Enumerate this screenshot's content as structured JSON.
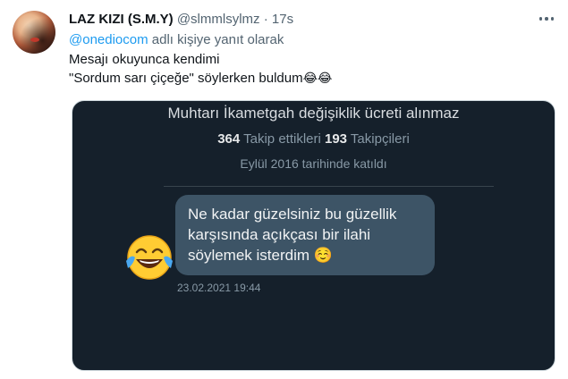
{
  "tweet": {
    "display_name": "LAZ KIZI (S.M.Y)",
    "handle": "@slmmlsylmz",
    "separator": "·",
    "time": "17s",
    "reply_mention": "@onediocom",
    "reply_suffix": " adlı kişiye yanıt olarak",
    "text_line1": "Mesajı okuyunca kendimi",
    "text_line2": "\"Sordum sarı çiçeğe\" söylerken buldum",
    "text_emoji": "😂😂"
  },
  "media": {
    "bio": "Muhtarı İkametgah değişiklik ücreti alınmaz",
    "following_count": "364",
    "following_label": " Takip ettikleri ",
    "followers_count": "193",
    "followers_label": " Takipçileri",
    "joined": "Eylül 2016 tarihinde katıldı",
    "message_line1": "Ne kadar güzelsiniz bu güzellik",
    "message_line2": "karşısında açıkçası bir ilahi",
    "message_line3": "söylemek isterdim",
    "message_emoji": "☺️",
    "timestamp": "23.02.2021 19:44"
  },
  "colors": {
    "accent": "#1d9bf0",
    "media_background": "#15202b",
    "bubble": "#3d5466"
  },
  "icons": {
    "more": "more-horizontal-icon",
    "laugh": "tears-of-joy-emoji"
  }
}
